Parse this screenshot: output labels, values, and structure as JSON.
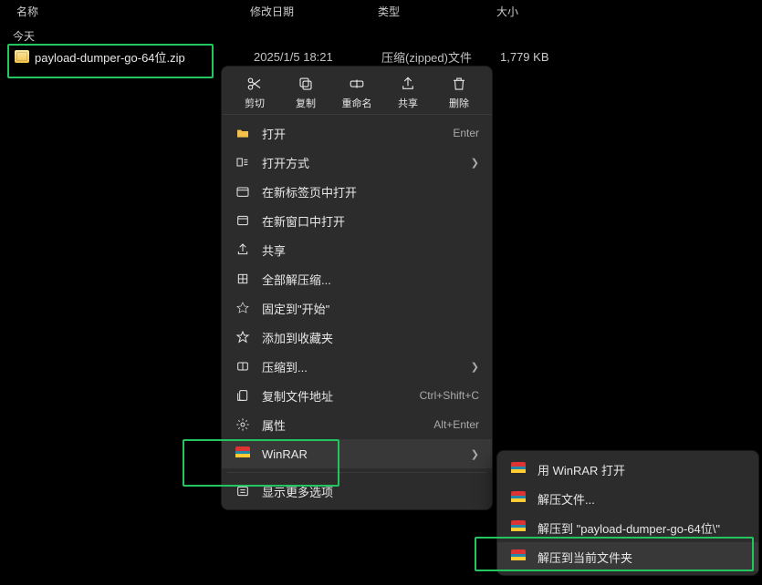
{
  "columns": {
    "name": "名称",
    "date": "修改日期",
    "type": "类型",
    "size": "大小"
  },
  "group": {
    "today": "今天"
  },
  "file": {
    "name": "payload-dumper-go-64位.zip",
    "date": "2025/1/5 18:21",
    "type": "压缩(zipped)文件",
    "size": "1,779 KB"
  },
  "actions": {
    "cut": "剪切",
    "copy": "复制",
    "rename": "重命名",
    "share": "共享",
    "delete": "删除"
  },
  "menu": {
    "open": "打开",
    "open_hint": "Enter",
    "open_with": "打开方式",
    "open_new_tab": "在新标签页中打开",
    "open_new_window": "在新窗口中打开",
    "share": "共享",
    "extract_all": "全部解压缩...",
    "pin_start": "固定到\"开始\"",
    "add_favorites": "添加到收藏夹",
    "compress_to": "压缩到...",
    "copy_path": "复制文件地址",
    "copy_path_hint": "Ctrl+Shift+C",
    "properties": "属性",
    "properties_hint": "Alt+Enter",
    "winrar": "WinRAR",
    "more_options": "显示更多选项"
  },
  "submenu": {
    "open_with_winrar": "用 WinRAR 打开",
    "extract_files": "解压文件...",
    "extract_to": "解压到 \"payload-dumper-go-64位\\\"",
    "extract_here": "解压到当前文件夹"
  }
}
